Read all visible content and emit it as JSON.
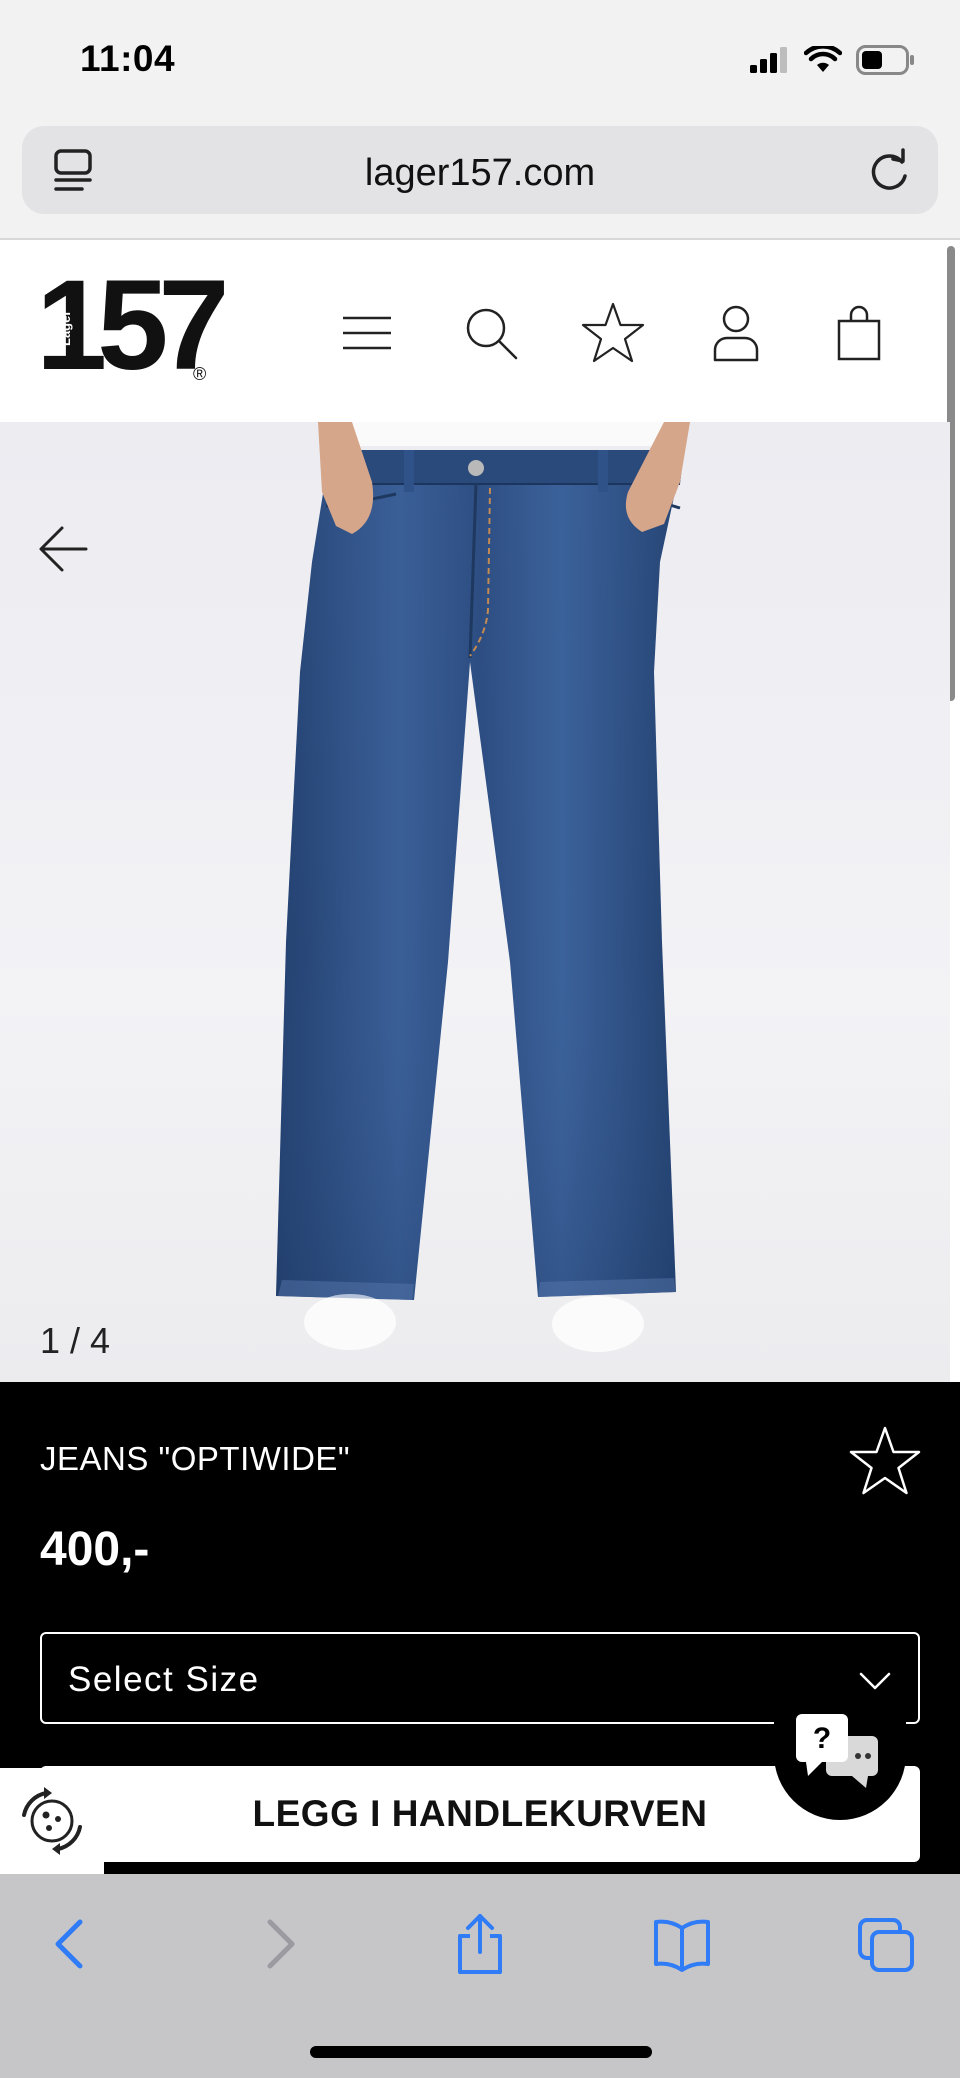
{
  "status_bar": {
    "time": "11:04"
  },
  "browser": {
    "url": "lager157.com"
  },
  "site": {
    "logo_text": "157",
    "logo_small": "Lager",
    "logo_reg": "®"
  },
  "gallery": {
    "counter": "1 / 4"
  },
  "product": {
    "title": "JEANS \"OPTIWIDE\"",
    "price": "400,-",
    "size_select_label": "Select Size",
    "add_to_cart_label": "LEGG I HANDLEKURVEN"
  },
  "chat": {
    "badge": "?"
  },
  "colors": {
    "denim": "#2e4f86",
    "accent_blue": "#2f7cf6"
  }
}
